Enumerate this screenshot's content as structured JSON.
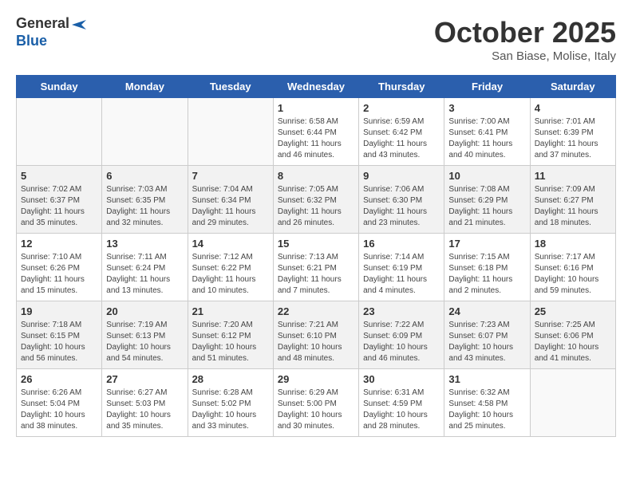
{
  "header": {
    "logo_general": "General",
    "logo_blue": "Blue",
    "month": "October 2025",
    "location": "San Biase, Molise, Italy"
  },
  "days_of_week": [
    "Sunday",
    "Monday",
    "Tuesday",
    "Wednesday",
    "Thursday",
    "Friday",
    "Saturday"
  ],
  "weeks": [
    {
      "shaded": false,
      "days": [
        {
          "num": "",
          "info": ""
        },
        {
          "num": "",
          "info": ""
        },
        {
          "num": "",
          "info": ""
        },
        {
          "num": "1",
          "info": "Sunrise: 6:58 AM\nSunset: 6:44 PM\nDaylight: 11 hours\nand 46 minutes."
        },
        {
          "num": "2",
          "info": "Sunrise: 6:59 AM\nSunset: 6:42 PM\nDaylight: 11 hours\nand 43 minutes."
        },
        {
          "num": "3",
          "info": "Sunrise: 7:00 AM\nSunset: 6:41 PM\nDaylight: 11 hours\nand 40 minutes."
        },
        {
          "num": "4",
          "info": "Sunrise: 7:01 AM\nSunset: 6:39 PM\nDaylight: 11 hours\nand 37 minutes."
        }
      ]
    },
    {
      "shaded": true,
      "days": [
        {
          "num": "5",
          "info": "Sunrise: 7:02 AM\nSunset: 6:37 PM\nDaylight: 11 hours\nand 35 minutes."
        },
        {
          "num": "6",
          "info": "Sunrise: 7:03 AM\nSunset: 6:35 PM\nDaylight: 11 hours\nand 32 minutes."
        },
        {
          "num": "7",
          "info": "Sunrise: 7:04 AM\nSunset: 6:34 PM\nDaylight: 11 hours\nand 29 minutes."
        },
        {
          "num": "8",
          "info": "Sunrise: 7:05 AM\nSunset: 6:32 PM\nDaylight: 11 hours\nand 26 minutes."
        },
        {
          "num": "9",
          "info": "Sunrise: 7:06 AM\nSunset: 6:30 PM\nDaylight: 11 hours\nand 23 minutes."
        },
        {
          "num": "10",
          "info": "Sunrise: 7:08 AM\nSunset: 6:29 PM\nDaylight: 11 hours\nand 21 minutes."
        },
        {
          "num": "11",
          "info": "Sunrise: 7:09 AM\nSunset: 6:27 PM\nDaylight: 11 hours\nand 18 minutes."
        }
      ]
    },
    {
      "shaded": false,
      "days": [
        {
          "num": "12",
          "info": "Sunrise: 7:10 AM\nSunset: 6:26 PM\nDaylight: 11 hours\nand 15 minutes."
        },
        {
          "num": "13",
          "info": "Sunrise: 7:11 AM\nSunset: 6:24 PM\nDaylight: 11 hours\nand 13 minutes."
        },
        {
          "num": "14",
          "info": "Sunrise: 7:12 AM\nSunset: 6:22 PM\nDaylight: 11 hours\nand 10 minutes."
        },
        {
          "num": "15",
          "info": "Sunrise: 7:13 AM\nSunset: 6:21 PM\nDaylight: 11 hours\nand 7 minutes."
        },
        {
          "num": "16",
          "info": "Sunrise: 7:14 AM\nSunset: 6:19 PM\nDaylight: 11 hours\nand 4 minutes."
        },
        {
          "num": "17",
          "info": "Sunrise: 7:15 AM\nSunset: 6:18 PM\nDaylight: 11 hours\nand 2 minutes."
        },
        {
          "num": "18",
          "info": "Sunrise: 7:17 AM\nSunset: 6:16 PM\nDaylight: 10 hours\nand 59 minutes."
        }
      ]
    },
    {
      "shaded": true,
      "days": [
        {
          "num": "19",
          "info": "Sunrise: 7:18 AM\nSunset: 6:15 PM\nDaylight: 10 hours\nand 56 minutes."
        },
        {
          "num": "20",
          "info": "Sunrise: 7:19 AM\nSunset: 6:13 PM\nDaylight: 10 hours\nand 54 minutes."
        },
        {
          "num": "21",
          "info": "Sunrise: 7:20 AM\nSunset: 6:12 PM\nDaylight: 10 hours\nand 51 minutes."
        },
        {
          "num": "22",
          "info": "Sunrise: 7:21 AM\nSunset: 6:10 PM\nDaylight: 10 hours\nand 48 minutes."
        },
        {
          "num": "23",
          "info": "Sunrise: 7:22 AM\nSunset: 6:09 PM\nDaylight: 10 hours\nand 46 minutes."
        },
        {
          "num": "24",
          "info": "Sunrise: 7:23 AM\nSunset: 6:07 PM\nDaylight: 10 hours\nand 43 minutes."
        },
        {
          "num": "25",
          "info": "Sunrise: 7:25 AM\nSunset: 6:06 PM\nDaylight: 10 hours\nand 41 minutes."
        }
      ]
    },
    {
      "shaded": false,
      "days": [
        {
          "num": "26",
          "info": "Sunrise: 6:26 AM\nSunset: 5:04 PM\nDaylight: 10 hours\nand 38 minutes."
        },
        {
          "num": "27",
          "info": "Sunrise: 6:27 AM\nSunset: 5:03 PM\nDaylight: 10 hours\nand 35 minutes."
        },
        {
          "num": "28",
          "info": "Sunrise: 6:28 AM\nSunset: 5:02 PM\nDaylight: 10 hours\nand 33 minutes."
        },
        {
          "num": "29",
          "info": "Sunrise: 6:29 AM\nSunset: 5:00 PM\nDaylight: 10 hours\nand 30 minutes."
        },
        {
          "num": "30",
          "info": "Sunrise: 6:31 AM\nSunset: 4:59 PM\nDaylight: 10 hours\nand 28 minutes."
        },
        {
          "num": "31",
          "info": "Sunrise: 6:32 AM\nSunset: 4:58 PM\nDaylight: 10 hours\nand 25 minutes."
        },
        {
          "num": "",
          "info": ""
        }
      ]
    }
  ]
}
